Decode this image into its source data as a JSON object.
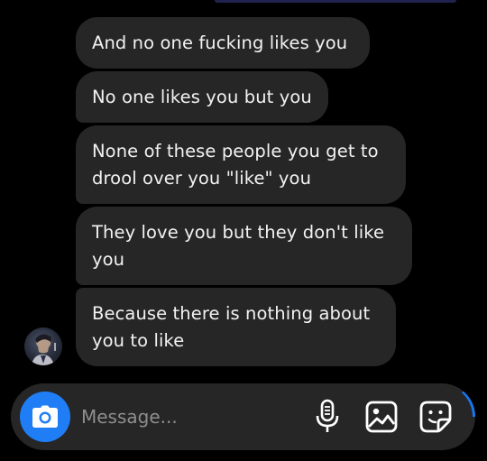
{
  "thread": {
    "messages": [
      {
        "text": "And no one fucking likes you"
      },
      {
        "text": "No one likes you but you"
      },
      {
        "text": "None of these people you get to\ndrool over you \"like\" you"
      },
      {
        "text": "They love you but they don't like\nyou"
      },
      {
        "text": "Because there is nothing about\nyou to like"
      }
    ]
  },
  "composer": {
    "placeholder": "Message...",
    "icons": {
      "camera": "camera-icon",
      "mic": "microphone-icon",
      "gallery": "image-icon",
      "sticker": "sticker-icon"
    }
  },
  "colors": {
    "background": "#000000",
    "bubble": "#262626",
    "text": "#f2f2f2",
    "accent": "#1f7ef5"
  }
}
